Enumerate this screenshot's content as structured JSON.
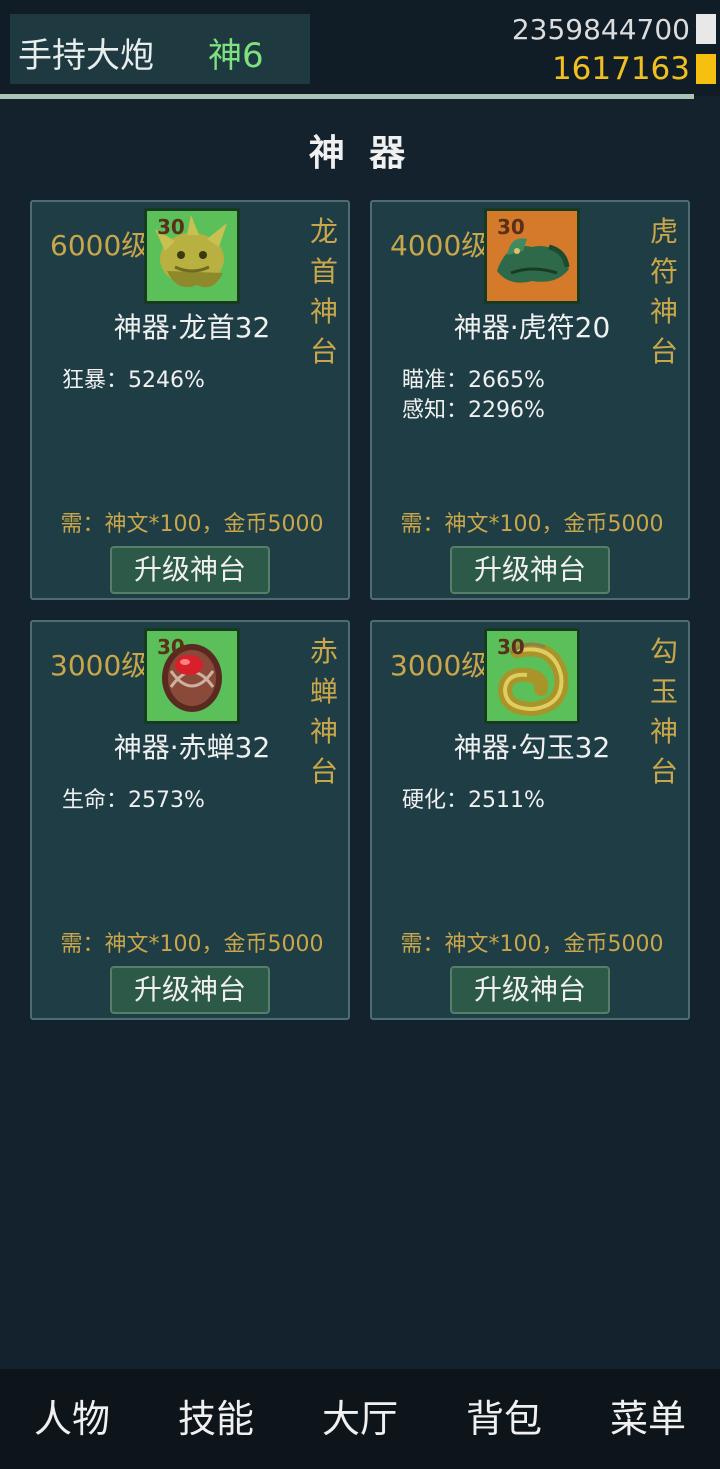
{
  "header": {
    "player_name": "手持大炮",
    "player_rank": "神6",
    "silver": "2359844700",
    "gold": "1617163"
  },
  "page_title": "神 器",
  "cards": [
    {
      "level": "6000级",
      "star": "30",
      "icon": "dragon-head-icon",
      "side_name": [
        "龙",
        "首",
        "神",
        "台"
      ],
      "artifact_name": "神器·龙首32",
      "stats": [
        "狂暴：5246%"
      ],
      "requirement": "需：神文*100，金币5000",
      "button": "升级神台"
    },
    {
      "level": "4000级",
      "star": "30",
      "icon": "tiger-talisman-icon",
      "side_name": [
        "虎",
        "符",
        "神",
        "台"
      ],
      "artifact_name": "神器·虎符20",
      "stats": [
        "瞄准：2665%",
        "感知：2296%"
      ],
      "requirement": "需：神文*100，金币5000",
      "button": "升级神台"
    },
    {
      "level": "3000级",
      "star": "30",
      "icon": "red-cicada-icon",
      "side_name": [
        "赤",
        "蝉",
        "神",
        "台"
      ],
      "artifact_name": "神器·赤蝉32",
      "stats": [
        "生命：2573%"
      ],
      "requirement": "需：神文*100，金币5000",
      "button": "升级神台"
    },
    {
      "level": "3000级",
      "star": "30",
      "icon": "jade-hook-icon",
      "side_name": [
        "勾",
        "玉",
        "神",
        "台"
      ],
      "artifact_name": "神器·勾玉32",
      "stats": [
        "硬化：2511%"
      ],
      "requirement": "需：神文*100，金币5000",
      "button": "升级神台"
    }
  ],
  "nav": [
    "人物",
    "技能",
    "大厅",
    "背包",
    "菜单"
  ]
}
